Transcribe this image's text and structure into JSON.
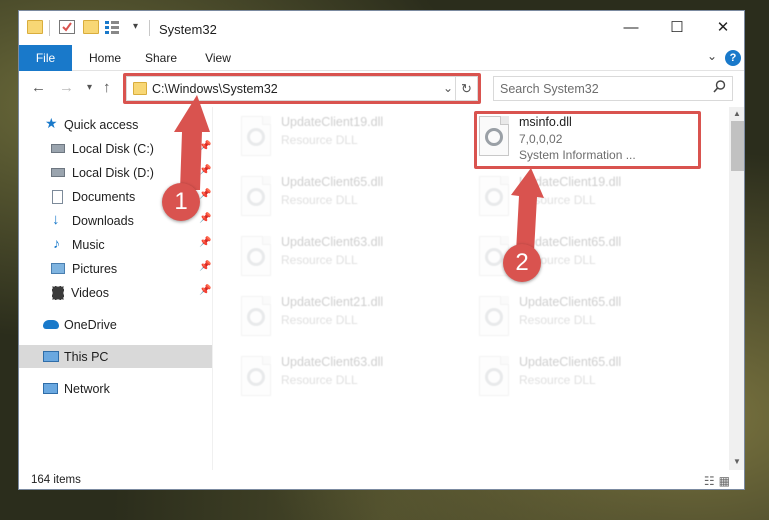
{
  "window": {
    "title": "System32"
  },
  "ribbon": {
    "tabs": [
      {
        "label": "File",
        "active": true
      },
      {
        "label": "Home"
      },
      {
        "label": "Share"
      },
      {
        "label": "View"
      }
    ],
    "help_icon": "question-mark-icon"
  },
  "address_bar": {
    "path": "C:\\Windows\\System32"
  },
  "search": {
    "placeholder": "Search System32"
  },
  "sidebar": {
    "items": [
      {
        "label": "Quick access",
        "icon": "star-icon"
      },
      {
        "label": "Local Disk (C:)",
        "icon": "drive-icon",
        "pinned": true
      },
      {
        "label": "Local Disk (D:)",
        "icon": "drive-icon",
        "pinned": true
      },
      {
        "label": "Documents",
        "icon": "document-icon",
        "pinned": true
      },
      {
        "label": "Downloads",
        "icon": "download-icon",
        "pinned": true
      },
      {
        "label": "Music",
        "icon": "music-icon",
        "pinned": true
      },
      {
        "label": "Pictures",
        "icon": "picture-icon",
        "pinned": true
      },
      {
        "label": "Videos",
        "icon": "video-icon",
        "pinned": true
      },
      {
        "label": "OneDrive",
        "icon": "cloud-icon"
      },
      {
        "label": "This PC",
        "icon": "computer-icon",
        "selected": true
      },
      {
        "label": "Network",
        "icon": "network-icon"
      }
    ]
  },
  "files": [
    {
      "name": "UpdateClient19.dll",
      "line2": "Resource DLL",
      "faded": true
    },
    {
      "name": "msinfo.dll",
      "line2": "7,0,0,02",
      "line3": "System Information ...",
      "highlighted": true
    },
    {
      "name": "UpdateClient65.dll",
      "line2": "Resource DLL",
      "faded": true
    },
    {
      "name": "UpdateClient19.dll",
      "line2": "Resource DLL",
      "faded": true
    },
    {
      "name": "UpdateClient63.dll",
      "line2": "Resource DLL",
      "faded": true
    },
    {
      "name": "UpdateClient65.dll",
      "line2": "Resource DLL",
      "faded": true
    },
    {
      "name": "UpdateClient21.dll",
      "line2": "Resource DLL",
      "faded": true
    },
    {
      "name": "UpdateClient65.dll",
      "line2": "Resource DLL",
      "faded": true
    },
    {
      "name": "UpdateClient63.dll",
      "line2": "Resource DLL",
      "faded": true
    },
    {
      "name": "UpdateClient65.dll",
      "line2": "Resource DLL",
      "faded": true
    }
  ],
  "status": {
    "item_count": "164 items"
  },
  "annotations": {
    "callout_1": "1",
    "callout_2": "2",
    "color": "#d9534f"
  }
}
